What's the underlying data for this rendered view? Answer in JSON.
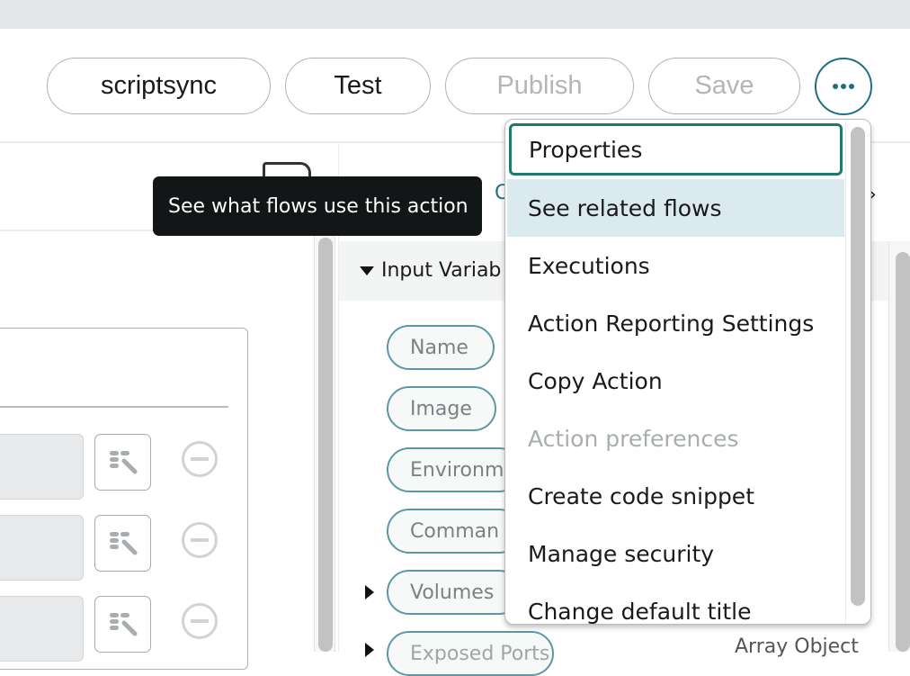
{
  "toolbar": {
    "buttons": [
      {
        "label": "scriptsync",
        "enabled": true
      },
      {
        "label": "Test",
        "enabled": true
      },
      {
        "label": "Publish",
        "enabled": false
      },
      {
        "label": "Save",
        "enabled": false
      }
    ],
    "more_icon": "ellipsis-icon"
  },
  "tooltip": {
    "text": "See what flows use this action"
  },
  "right_panel": {
    "tab_partial": "C",
    "section": {
      "title": "Input Variab",
      "expanded": true
    },
    "variables": [
      {
        "label": "Name",
        "expandable": false
      },
      {
        "label": "Image",
        "expandable": false
      },
      {
        "label": "Environm",
        "expandable": false
      },
      {
        "label": "Comman",
        "expandable": false
      },
      {
        "label": "Volumes",
        "expandable": true
      },
      {
        "label": "Exposed Ports",
        "expandable": true,
        "type": "Array Object"
      }
    ]
  },
  "menu": {
    "items": [
      {
        "label": "Properties",
        "state": "focused"
      },
      {
        "label": "See related flows",
        "state": "hover"
      },
      {
        "label": "Executions",
        "state": "normal"
      },
      {
        "label": "Action Reporting Settings",
        "state": "normal"
      },
      {
        "label": "Copy Action",
        "state": "normal"
      },
      {
        "label": "Action preferences",
        "state": "disabled"
      },
      {
        "label": "Create code snippet",
        "state": "normal"
      },
      {
        "label": "Manage security",
        "state": "normal"
      },
      {
        "label": "Change default title",
        "state": "normal"
      }
    ]
  },
  "colors": {
    "accent": "#1e6f82",
    "focus_border": "#1f7a6e",
    "hover_bg": "#dbeaef",
    "tooltip_bg": "#131617",
    "pill_border": "#5c98a6"
  }
}
